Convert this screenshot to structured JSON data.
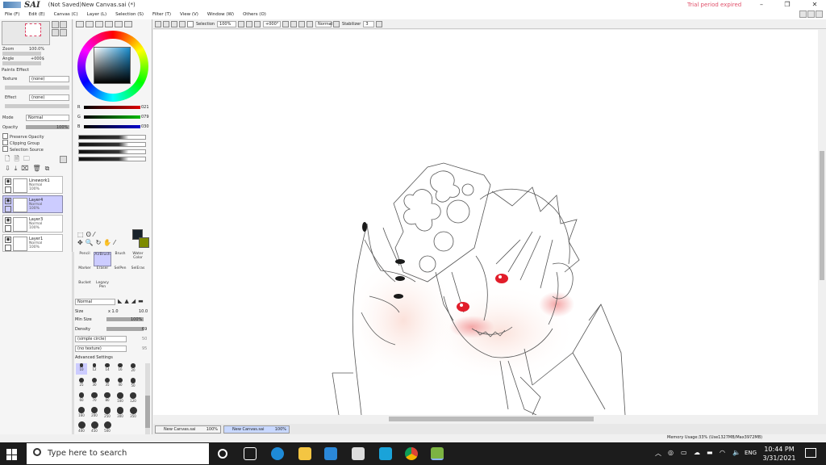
{
  "window": {
    "app_name": "SAI",
    "doc_title": "(Not Saved)New Canvas.sai (*)",
    "trial_notice": "Trial period expired",
    "controls": [
      "–",
      "❐",
      "✕"
    ]
  },
  "menu": [
    "File (F)",
    "Edit (E)",
    "Canvas (C)",
    "Layer (L)",
    "Selection (S)",
    "Filter (T)",
    "View (V)",
    "Window (W)",
    "Others (O)"
  ],
  "navigator": {
    "zoom_label": "Zoom",
    "zoom_value": "100.0%",
    "angle_label": "Angle",
    "angle_value": "+000$"
  },
  "paints_effect": {
    "title": "Paints Effect",
    "texture_label": "Texture",
    "texture_value": "(none)",
    "effect_label": "Effect",
    "effect_value": "(none)",
    "mode_label": "Mode",
    "mode_value": "Normal",
    "opacity_label": "Opacity",
    "opacity_value": "100%",
    "checks": [
      "Preserve Opacity",
      "Clipping Group",
      "Selection Source"
    ]
  },
  "layers": [
    {
      "name": "Linework1",
      "mode": "Normal",
      "opacity": "100%",
      "selected": false
    },
    {
      "name": "Layer4",
      "mode": "Normal",
      "opacity": "100%",
      "selected": true
    },
    {
      "name": "Layer3",
      "mode": "Normal",
      "opacity": "100%",
      "selected": false
    },
    {
      "name": "Layer1",
      "mode": "Normal",
      "opacity": "100%",
      "selected": false
    }
  ],
  "color": {
    "r_label": "R",
    "r_value": "021",
    "g_label": "G",
    "g_value": "079",
    "b_label": "B",
    "b_value": "030",
    "front": "#18222b",
    "back": "#7d8a00"
  },
  "brushes": [
    {
      "name": "Pencil",
      "selected": false
    },
    {
      "name": "AirBrush",
      "selected": true
    },
    {
      "name": "Brush",
      "selected": false
    },
    {
      "name": "Water Color",
      "selected": false
    },
    {
      "name": "Marker",
      "selected": false
    },
    {
      "name": "Eraser",
      "selected": false
    },
    {
      "name": "SelPen",
      "selected": false
    },
    {
      "name": "SelEras",
      "selected": false
    },
    {
      "name": "Bucket",
      "selected": false
    },
    {
      "name": "Legacy Pen",
      "selected": false
    }
  ],
  "brush_props": {
    "mode_value": "Normal",
    "size_label": "Size",
    "size_mult": "x 1.0",
    "size_value": "10.0",
    "minsize_label": "Min Size",
    "minsize_value": "100%",
    "density_label": "Density",
    "density_value": "69",
    "shape_value": "(simple circle)",
    "shape_num": "50",
    "texture_value": "(no texture)",
    "texture_num": "95",
    "advanced_label": "Advanced Settings"
  },
  "brush_sizes": [
    "10",
    "12",
    "14",
    "16",
    "20",
    "25",
    "30",
    "35",
    "40",
    "50",
    "60",
    "70",
    "80",
    "100",
    "120",
    "160",
    "200",
    "250",
    "300",
    "350",
    "400",
    "450",
    "500"
  ],
  "canvas_toolbar": {
    "selection_label": "Selection",
    "zoom_value": "100%",
    "angle_value": "+000°",
    "blend_value": "Normal",
    "stabilizer_label": "Stabilizer",
    "stabilizer_value": "3"
  },
  "doc_tabs": [
    {
      "name": "New Canvas.sai",
      "zoom": "100%",
      "selected": false
    },
    {
      "name": "New Canvas.sai",
      "zoom": "100%",
      "selected": true
    }
  ],
  "status": {
    "memory": "Memory Usage:33% (Use1327MB/Max3972MB)"
  },
  "taskbar": {
    "search_placeholder": "Type here to search",
    "language": "ENG",
    "time": "10:44 PM",
    "date": "3/31/2021",
    "accent": "#1c1c1c"
  }
}
